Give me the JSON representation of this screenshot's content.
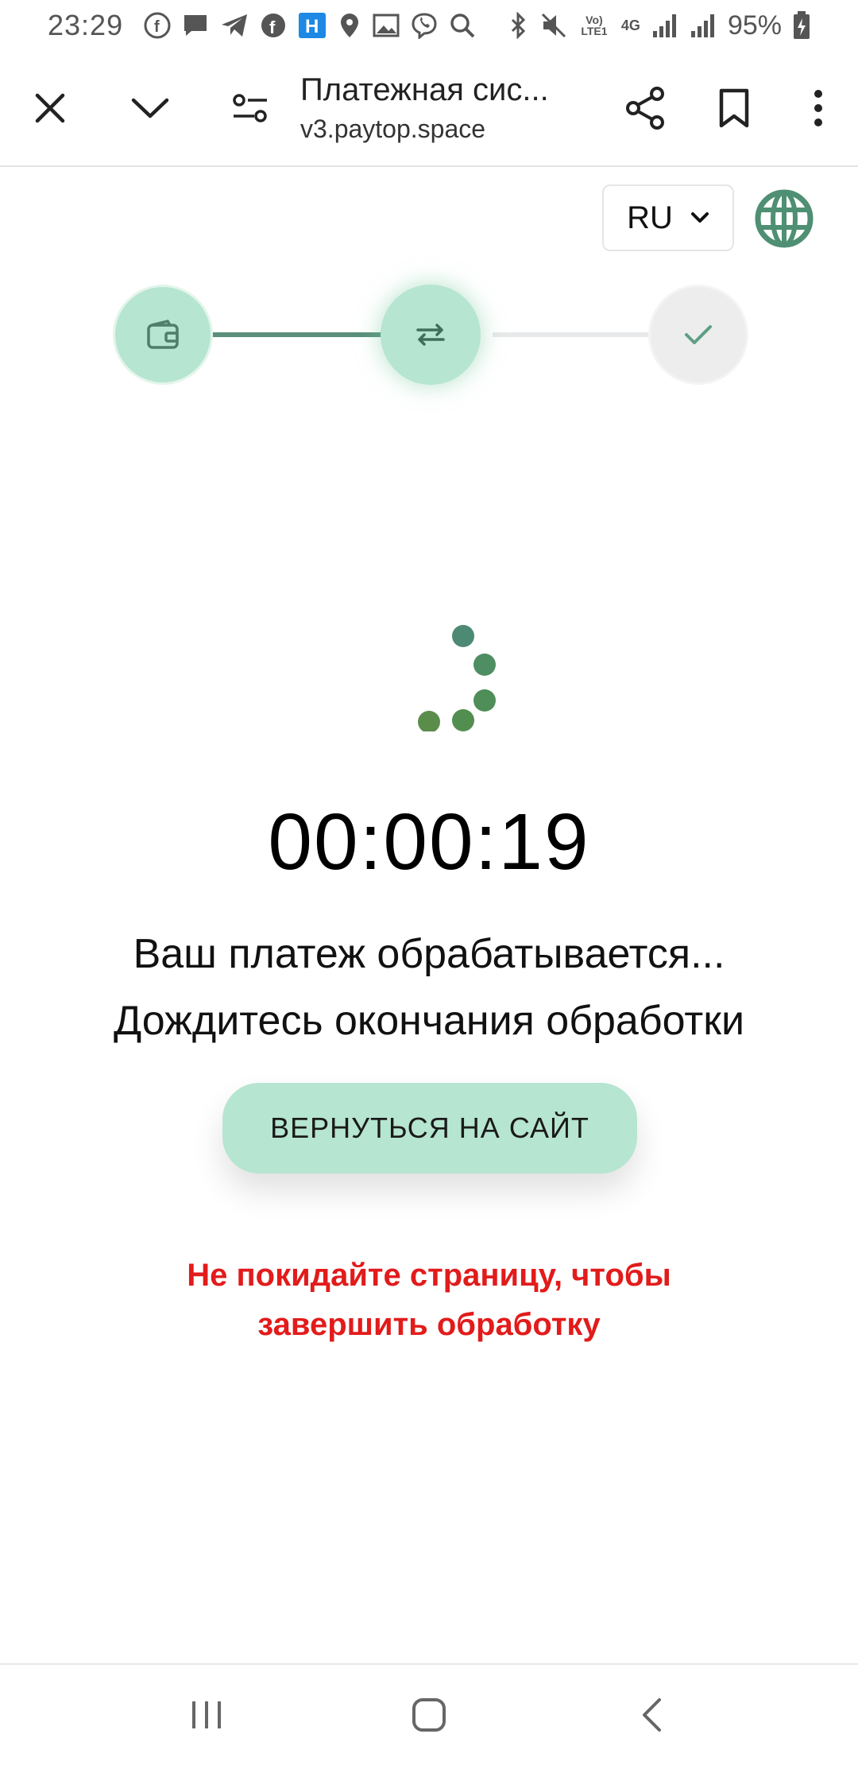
{
  "status_bar": {
    "time": "23:29",
    "network_top": "Vo) LTE1",
    "network_type": "4G",
    "battery": "95%"
  },
  "browser": {
    "title": "Платежная сис...",
    "url": "v3.paytop.space"
  },
  "page": {
    "language": "RU",
    "steps": [
      {
        "icon": "wallet-icon",
        "state": "done"
      },
      {
        "icon": "exchange-icon",
        "state": "active"
      },
      {
        "icon": "check-icon",
        "state": "pending"
      }
    ],
    "timer": "00:00:19",
    "processing_message": "Ваш платеж обрабатывается...",
    "wait_message": "Дождитесь окончания обработки",
    "back_button_label": "ВЕРНУТЬСЯ НА САЙТ",
    "warning_line1": "Не покидайте страницу, чтобы",
    "warning_line2": "завершить обработку"
  },
  "colors": {
    "accent": "#b6e5d1",
    "accent_dark": "#5a8f7b",
    "warning": "#e21b1b"
  }
}
